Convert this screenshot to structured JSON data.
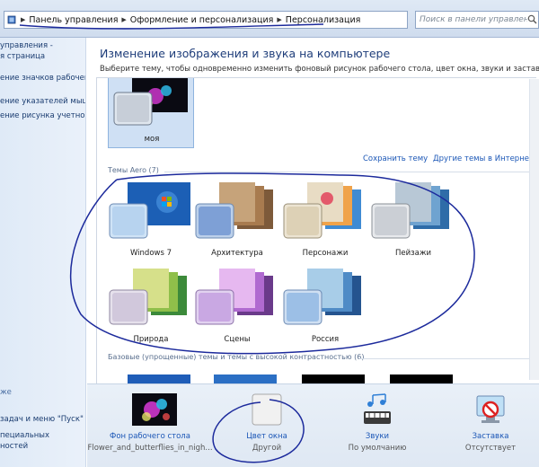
{
  "breadcrumb": {
    "items": [
      "Панель управления",
      "Оформление и персонализация",
      "Персонализация"
    ]
  },
  "search": {
    "placeholder": "Поиск в панели управления"
  },
  "sidebar": {
    "links": [
      "управления -",
      "я страница",
      "ение значков рабочего",
      "ение указателей мыши",
      "ение рисунка учетной"
    ],
    "see_also": "же",
    "bottom_links": [
      "задач и меню \"Пуск\"",
      "пециальных",
      "ностей"
    ]
  },
  "main": {
    "title": "Изменение изображения и звука на компьютере",
    "subtitle": "Выберите тему, чтобы одновременно изменить фоновый рисунок рабочего стола, цвет окна, звуки и заставку.",
    "my_theme": "моя",
    "save_theme": "Сохранить тему",
    "online_themes": "Другие темы в Интернете",
    "aero_header": "Темы Aero (7)",
    "aero_themes": [
      "Windows 7",
      "Архитектура",
      "Персонажи",
      "Пейзажи",
      "Природа",
      "Сцены",
      "Россия"
    ],
    "basic_header": "Базовые (упрощенные) темы и темы с высокой контрастностью (6)"
  },
  "bottom": {
    "background": {
      "title": "Фон рабочего стола",
      "sub": "Flower_and_butterflies_in_nigh..."
    },
    "color": {
      "title": "Цвет окна",
      "sub": "Другой"
    },
    "sounds": {
      "title": "Звуки",
      "sub": "По умолчанию"
    },
    "screensaver": {
      "title": "Заставка",
      "sub": "Отсутствует"
    }
  },
  "colors": {
    "accent_link": "#1a56b6",
    "title_blue": "#1e3d7a",
    "selection": "#cfe0f4",
    "ink": "#1c2a9c"
  }
}
